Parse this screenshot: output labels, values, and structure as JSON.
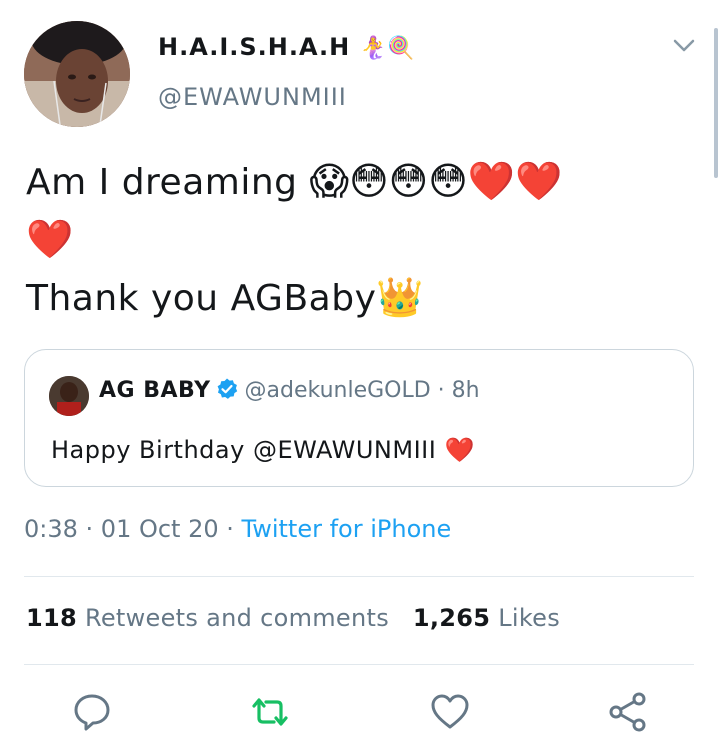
{
  "author": {
    "display_name": "H.A.I.S.H.A.H",
    "name_emojis": "🧜‍♀️🍭",
    "handle": "@EWAWUNMIII"
  },
  "tweet": {
    "line1_text": "Am I dreaming ",
    "line1_emojis": "😱😳😳😳❤️❤️",
    "line2_emojis": "❤️",
    "line3_text": "Thank you AGBaby",
    "line3_emojis": "👑"
  },
  "quoted": {
    "name": "AG BABY",
    "handle": "@adekunleGOLD",
    "separator": " · ",
    "age": "8h",
    "text": "Happy Birthday @EWAWUNMIII ",
    "text_emoji": "❤️"
  },
  "meta": {
    "time": "0:38",
    "date": "01 Oct 20",
    "separator": " · ",
    "source": "Twitter for iPhone"
  },
  "stats": {
    "retweets_count": "118",
    "retweets_label": "Retweets and comments",
    "likes_count": "1,265",
    "likes_label": "Likes"
  },
  "icons": {
    "reply": "reply-icon",
    "retweet": "retweet-icon",
    "like": "heart-icon",
    "share": "share-icon",
    "more": "chevron-down-icon",
    "verified": "verified-badge-icon"
  },
  "colors": {
    "accent": "#1da1f2",
    "retweet": "#17bf63",
    "muted": "#657786",
    "text": "#14171a",
    "border": "#ccd6dd"
  }
}
